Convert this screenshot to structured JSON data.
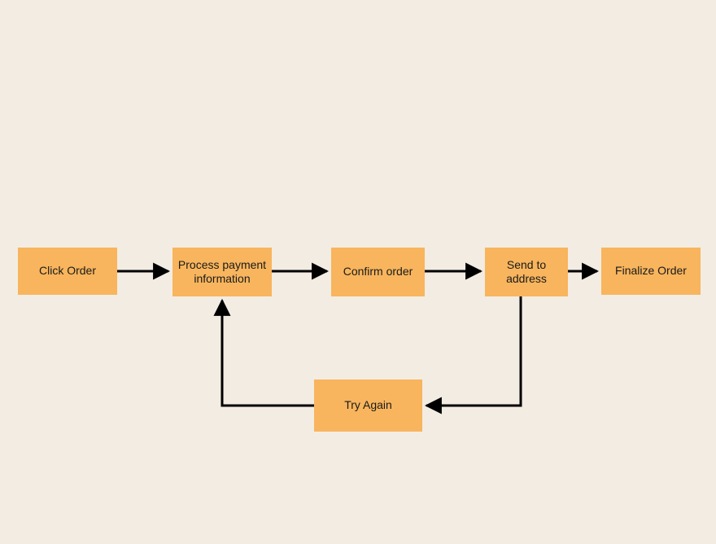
{
  "colors": {
    "background": "#f3ece2",
    "node_fill": "#f8b55d",
    "edge": "#000000"
  },
  "nodes": {
    "click_order": "Click Order",
    "process_payment": "Process payment information",
    "confirm_order": "Confirm order",
    "send_to_address": "Send to address",
    "finalize_order": "Finalize Order",
    "try_again": "Try Again"
  },
  "edges": [
    {
      "from": "click_order",
      "to": "process_payment"
    },
    {
      "from": "process_payment",
      "to": "confirm_order"
    },
    {
      "from": "confirm_order",
      "to": "send_to_address"
    },
    {
      "from": "send_to_address",
      "to": "finalize_order"
    },
    {
      "from": "send_to_address",
      "to": "try_again"
    },
    {
      "from": "try_again",
      "to": "process_payment"
    }
  ]
}
